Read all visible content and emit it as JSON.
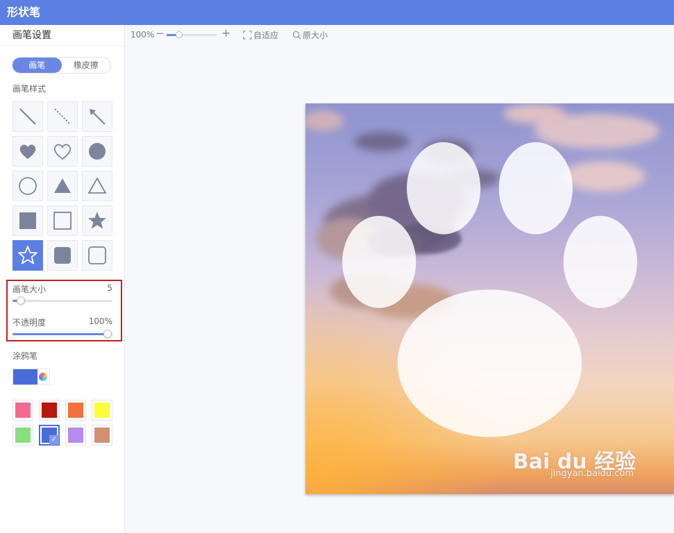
{
  "app": {
    "title": "形状笔"
  },
  "sidebar": {
    "header": "画笔设置",
    "modes": [
      {
        "label": "画笔",
        "active": true
      },
      {
        "label": "橡皮擦",
        "active": false
      }
    ],
    "brush_style_label": "画笔样式",
    "shapes": [
      {
        "name": "line",
        "icon": "line-icon"
      },
      {
        "name": "dashed-line",
        "icon": "dashed-line-icon"
      },
      {
        "name": "arrow",
        "icon": "arrow-icon"
      },
      {
        "name": "heart-filled",
        "icon": "heart-filled-icon"
      },
      {
        "name": "heart-outline",
        "icon": "heart-outline-icon"
      },
      {
        "name": "circle-filled",
        "icon": "circle-filled-icon"
      },
      {
        "name": "circle-outline",
        "icon": "circle-outline-icon"
      },
      {
        "name": "triangle-filled",
        "icon": "triangle-filled-icon"
      },
      {
        "name": "triangle-outline",
        "icon": "triangle-outline-icon"
      },
      {
        "name": "square-filled",
        "icon": "square-filled-icon"
      },
      {
        "name": "square-outline",
        "icon": "square-outline-icon"
      },
      {
        "name": "star-filled",
        "icon": "star-filled-icon"
      },
      {
        "name": "star-outline",
        "icon": "star-outline-icon",
        "active": true
      },
      {
        "name": "rounded-square-filled",
        "icon": "rounded-square-filled-icon"
      },
      {
        "name": "rounded-square-outline",
        "icon": "rounded-square-outline-icon"
      }
    ],
    "brush_size": {
      "label": "画笔大小",
      "value": "5",
      "fraction": 0.08
    },
    "opacity": {
      "label": "不透明度",
      "value": "100%",
      "fraction": 0.95
    },
    "doodle_label": "涂鸦笔",
    "current_color": "#4a6cd8",
    "palette": [
      {
        "color": "#f46a8e"
      },
      {
        "color": "#b8180e"
      },
      {
        "color": "#f5713c"
      },
      {
        "color": "#fcfc3a"
      },
      {
        "color": "#88e07d"
      },
      {
        "color": "#4a6cd8",
        "selected": true
      },
      {
        "color": "#b78af0"
      },
      {
        "color": "#d38f72"
      }
    ]
  },
  "toolbar": {
    "zoom": "100%",
    "minus": "−",
    "plus": "+",
    "fit_label": "自适应",
    "original_label": "原大小"
  },
  "canvas": {
    "watermark": "Bai du 经验",
    "watermark_url": "jingyan.baidu.com",
    "accent": "#5b7fe3"
  }
}
